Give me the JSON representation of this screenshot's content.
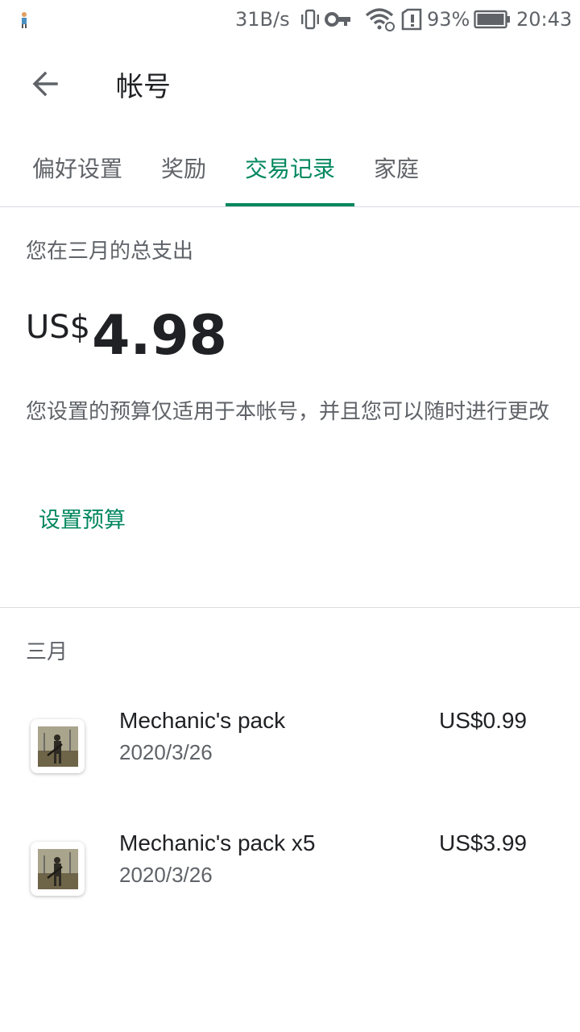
{
  "status_bar": {
    "net_speed": "31B/s",
    "battery_percent": "93%",
    "time": "20:43",
    "icons": [
      "notification-figure-icon",
      "vibrate-icon",
      "vpn-key-icon",
      "wifi-icon",
      "sim-alert-icon",
      "battery-icon"
    ]
  },
  "app_bar": {
    "title": "帐号",
    "back_icon": "arrow-left-icon"
  },
  "tabs": [
    {
      "label": "偏好设置",
      "active": false
    },
    {
      "label": "奖励",
      "active": false
    },
    {
      "label": "交易记录",
      "active": true
    },
    {
      "label": "家庭",
      "active": false
    }
  ],
  "summary": {
    "label": "您在三月的总支出",
    "currency": "US$",
    "amount": "4.98",
    "note": "您设置的预算仅适用于本帐号，并且您可以随时进行更改",
    "budget_button": "设置预算"
  },
  "history": {
    "month": "三月",
    "transactions": [
      {
        "name": "Mechanic's pack",
        "date": "2020/3/26",
        "price": "US$0.99",
        "icon": "game-soldier-icon"
      },
      {
        "name": "Mechanic's pack x5",
        "date": "2020/3/26",
        "price": "US$3.99",
        "icon": "game-soldier-icon"
      }
    ]
  },
  "colors": {
    "accent": "#01875f",
    "text_primary": "#202124",
    "text_secondary": "#5f6368",
    "divider": "#dadce0"
  }
}
